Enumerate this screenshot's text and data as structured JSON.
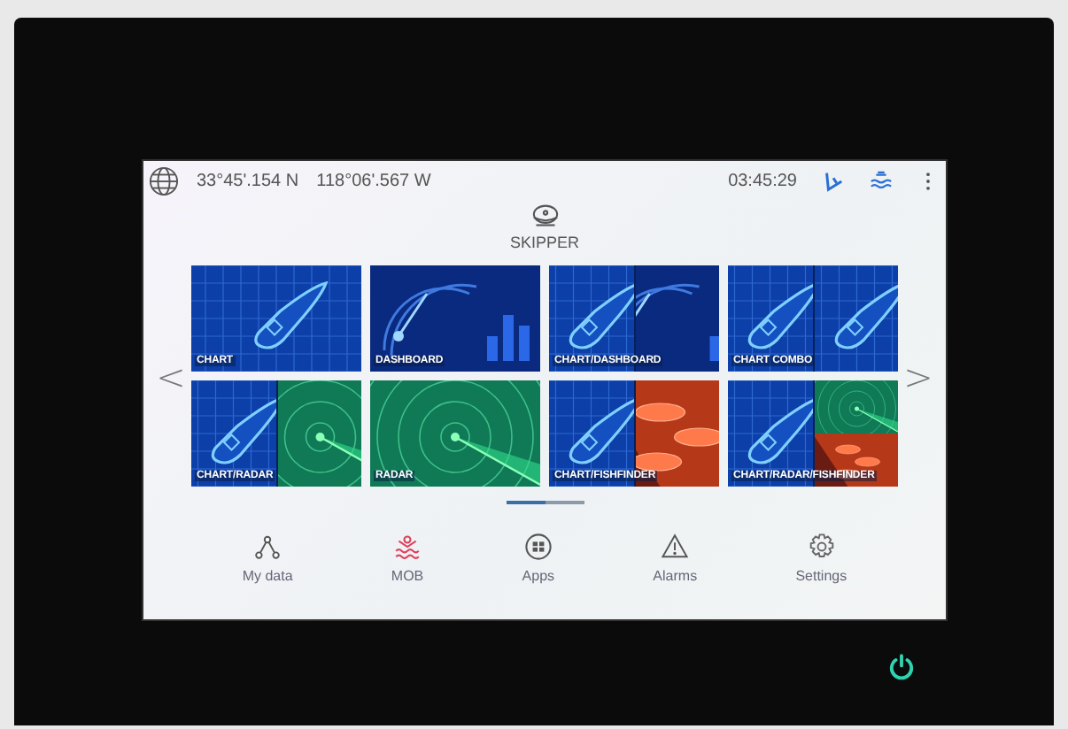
{
  "status_bar": {
    "latitude": "33°45'.154 N",
    "longitude": "118°06'.567 W",
    "time": "03:45:29"
  },
  "profile": {
    "label": "SKIPPER"
  },
  "nav_arrows": {
    "previous": "<",
    "next": ">"
  },
  "tiles": [
    {
      "label": "CHART",
      "panes": [
        {
          "kind": "chart"
        }
      ]
    },
    {
      "label": "DASHBOARD",
      "panes": [
        {
          "kind": "dashboard"
        }
      ]
    },
    {
      "label": "CHART/DASHBOARD",
      "panes": [
        {
          "kind": "chart"
        },
        {
          "kind": "dashboard"
        }
      ]
    },
    {
      "label": "CHART COMBO",
      "panes": [
        {
          "kind": "chart"
        },
        {
          "kind": "chart"
        }
      ]
    },
    {
      "label": "CHART/RADAR",
      "panes": [
        {
          "kind": "chart"
        },
        {
          "kind": "radar"
        }
      ]
    },
    {
      "label": "RADAR",
      "panes": [
        {
          "kind": "radar"
        }
      ]
    },
    {
      "label": "CHART/FISHFINDER",
      "panes": [
        {
          "kind": "chart"
        },
        {
          "kind": "fishfinder"
        }
      ]
    },
    {
      "label": "CHART/RADAR/FISHFINDER",
      "panes": [
        {
          "kind": "chart"
        },
        {
          "kind": "radar"
        },
        {
          "kind": "fishfinder"
        }
      ]
    }
  ],
  "pages": [
    {
      "selected": true
    },
    {
      "selected": false
    }
  ],
  "bottom_nav": [
    {
      "label": "My data",
      "kind": "mydata"
    },
    {
      "label": "MOB",
      "kind": "mob"
    },
    {
      "label": "Apps",
      "kind": "apps"
    },
    {
      "label": "Alarms",
      "kind": "alarms"
    },
    {
      "label": "Settings",
      "kind": "settings"
    }
  ]
}
